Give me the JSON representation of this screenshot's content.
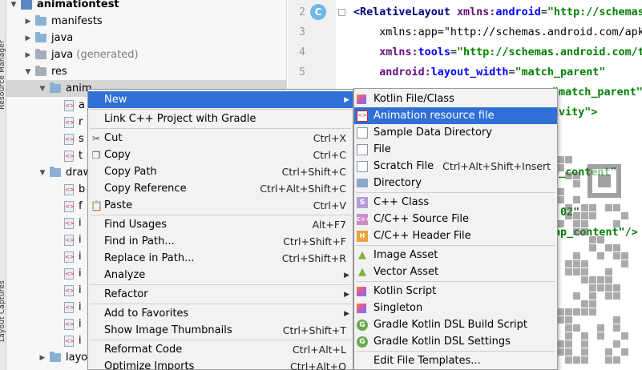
{
  "left_strip": {
    "labels": [
      "Resource Manager",
      "Layout Captures"
    ]
  },
  "project_tree": {
    "rows": [
      {
        "label": "animationtest",
        "suffix": "",
        "type": "module",
        "bold": true
      },
      {
        "label": "manifests",
        "suffix": "",
        "type": "folder"
      },
      {
        "label": "java",
        "suffix": "",
        "type": "folder"
      },
      {
        "label": "java",
        "suffix": "(generated)",
        "type": "folder-gray"
      },
      {
        "label": "res",
        "suffix": "",
        "type": "folder-gray"
      },
      {
        "label": "anim",
        "suffix": "",
        "type": "folder"
      },
      {
        "label": "a",
        "suffix": "",
        "type": "file"
      },
      {
        "label": "r",
        "suffix": "",
        "type": "file"
      },
      {
        "label": "s",
        "suffix": "",
        "type": "file"
      },
      {
        "label": "t",
        "suffix": "",
        "type": "file"
      },
      {
        "label": "draw",
        "suffix": "",
        "type": "folder"
      },
      {
        "label": "b",
        "suffix": "",
        "type": "file"
      },
      {
        "label": "f",
        "suffix": "",
        "type": "file"
      },
      {
        "label": "i",
        "suffix": "",
        "type": "file"
      },
      {
        "label": "i",
        "suffix": "",
        "type": "file"
      },
      {
        "label": "i",
        "suffix": "",
        "type": "file"
      },
      {
        "label": "i",
        "suffix": "",
        "type": "file"
      },
      {
        "label": "i",
        "suffix": "",
        "type": "file"
      },
      {
        "label": "i",
        "suffix": "",
        "type": "file"
      },
      {
        "label": "i",
        "suffix": "",
        "type": "file"
      },
      {
        "label": "i",
        "suffix": "",
        "type": "file"
      },
      {
        "label": "layo",
        "suffix": "",
        "type": "folder"
      }
    ]
  },
  "editor": {
    "badge": "C",
    "lines": [
      {
        "no": "2",
        "parts": [
          [
            "tag",
            "<RelativeLayout "
          ],
          [
            "ns",
            "xmlns:"
          ],
          [
            "attr",
            "android"
          ],
          [
            "plain",
            "="
          ],
          [
            "str",
            "\"http://schemas."
          ]
        ]
      },
      {
        "no": "3",
        "parts": [
          [
            "plain",
            "    xmlns:app=\"http://schemas.android.com/apk/"
          ]
        ]
      },
      {
        "no": "4",
        "parts": [
          [
            "plain",
            "    "
          ],
          [
            "ns",
            "xmlns:"
          ],
          [
            "attr",
            "tools"
          ],
          [
            "plain",
            "="
          ],
          [
            "str",
            "\"http://schemas.android.com/to"
          ]
        ]
      },
      {
        "no": "5",
        "parts": [
          [
            "plain",
            "    "
          ],
          [
            "ns",
            "android:"
          ],
          [
            "attr",
            "layout_width"
          ],
          [
            "plain",
            "="
          ],
          [
            "str",
            "\"match_parent\""
          ]
        ]
      },
      {
        "no": "",
        "parts": [
          [
            "str",
            "\"match_parent\""
          ]
        ]
      },
      {
        "no": "",
        "parts": [
          [
            "str",
            "ivity\">"
          ]
        ]
      },
      {
        "no": "",
        "parts": [
          [
            "str",
            "p_content\""
          ]
        ]
      },
      {
        "no": "",
        "parts": [
          [
            "str",
            "02\""
          ]
        ]
      },
      {
        "no": "",
        "parts": [
          [
            "str",
            "ap_content\"/>"
          ]
        ]
      }
    ]
  },
  "context_menu": {
    "items": [
      {
        "icon": "",
        "label": "New",
        "shortcut": "",
        "submenu": true,
        "highlighted": true
      },
      {
        "sep": true
      },
      {
        "icon": "",
        "label": "Link C++ Project with Gradle",
        "shortcut": ""
      },
      {
        "sep": true
      },
      {
        "icon": "scissors-icon",
        "label": "Cut",
        "shortcut": "Ctrl+X"
      },
      {
        "icon": "copy-icon",
        "label": "Copy",
        "shortcut": "Ctrl+C"
      },
      {
        "icon": "",
        "label": "Copy Path",
        "shortcut": "Ctrl+Shift+C"
      },
      {
        "icon": "",
        "label": "Copy Reference",
        "shortcut": "Ctrl+Alt+Shift+C"
      },
      {
        "icon": "clipboard-icon",
        "label": "Paste",
        "shortcut": "Ctrl+V"
      },
      {
        "sep": true
      },
      {
        "icon": "",
        "label": "Find Usages",
        "shortcut": "Alt+F7"
      },
      {
        "icon": "",
        "label": "Find in Path...",
        "shortcut": "Ctrl+Shift+F"
      },
      {
        "icon": "",
        "label": "Replace in Path...",
        "shortcut": "Ctrl+Shift+R"
      },
      {
        "icon": "",
        "label": "Analyze",
        "shortcut": "",
        "submenu": true
      },
      {
        "sep": true
      },
      {
        "icon": "",
        "label": "Refactor",
        "shortcut": "",
        "submenu": true
      },
      {
        "sep": true
      },
      {
        "icon": "",
        "label": "Add to Favorites",
        "shortcut": "",
        "submenu": true
      },
      {
        "icon": "",
        "label": "Show Image Thumbnails",
        "shortcut": "Ctrl+Shift+T"
      },
      {
        "sep": true
      },
      {
        "icon": "",
        "label": "Reformat Code",
        "shortcut": "Ctrl+Alt+L"
      },
      {
        "icon": "",
        "label": "Optimize Imports",
        "shortcut": "Ctrl+Alt+O"
      }
    ]
  },
  "new_submenu": {
    "items": [
      {
        "icon": "kotlin-icon",
        "glyph": "",
        "label": "Kotlin File/Class",
        "shortcut": ""
      },
      {
        "icon": "animation-file-icon",
        "glyph": "<>",
        "label": "Animation resource file",
        "shortcut": "",
        "highlighted": true
      },
      {
        "icon": "file-icon",
        "glyph": "",
        "label": "Sample Data Directory",
        "shortcut": ""
      },
      {
        "icon": "file-icon",
        "glyph": "",
        "label": "File",
        "shortcut": ""
      },
      {
        "icon": "file-icon",
        "glyph": "",
        "label": "Scratch File",
        "shortcut": "Ctrl+Alt+Shift+Insert"
      },
      {
        "icon": "folder-icon",
        "glyph": "",
        "label": "Directory",
        "shortcut": ""
      },
      {
        "sep": true
      },
      {
        "icon": "cpp-class-icon",
        "glyph": "S",
        "label": "C++ Class",
        "shortcut": ""
      },
      {
        "icon": "cpp-source-icon",
        "glyph": "C++",
        "label": "C/C++ Source File",
        "shortcut": ""
      },
      {
        "icon": "cpp-header-icon",
        "glyph": "H",
        "label": "C/C++ Header File",
        "shortcut": ""
      },
      {
        "sep": true
      },
      {
        "icon": "android-icon",
        "glyph": "▲",
        "label": "Image Asset",
        "shortcut": ""
      },
      {
        "icon": "android-icon",
        "glyph": "▲",
        "label": "Vector Asset",
        "shortcut": ""
      },
      {
        "sep": true
      },
      {
        "icon": "kotlin-icon",
        "glyph": "",
        "label": "Kotlin Script",
        "shortcut": ""
      },
      {
        "icon": "kotlin-icon",
        "glyph": "",
        "label": "Singleton",
        "shortcut": ""
      },
      {
        "icon": "gradle-icon",
        "glyph": "G",
        "label": "Gradle Kotlin DSL Build Script",
        "shortcut": ""
      },
      {
        "icon": "gradle-icon",
        "glyph": "G",
        "label": "Gradle Kotlin DSL Settings",
        "shortcut": ""
      },
      {
        "sep": true
      },
      {
        "icon": "",
        "glyph": "",
        "label": "Edit File Templates...",
        "shortcut": ""
      }
    ]
  },
  "colors": {
    "highlight": "#2f6fd6",
    "menu_bg": "#f2f2f2",
    "tree_bg": "#f7f7f7"
  }
}
